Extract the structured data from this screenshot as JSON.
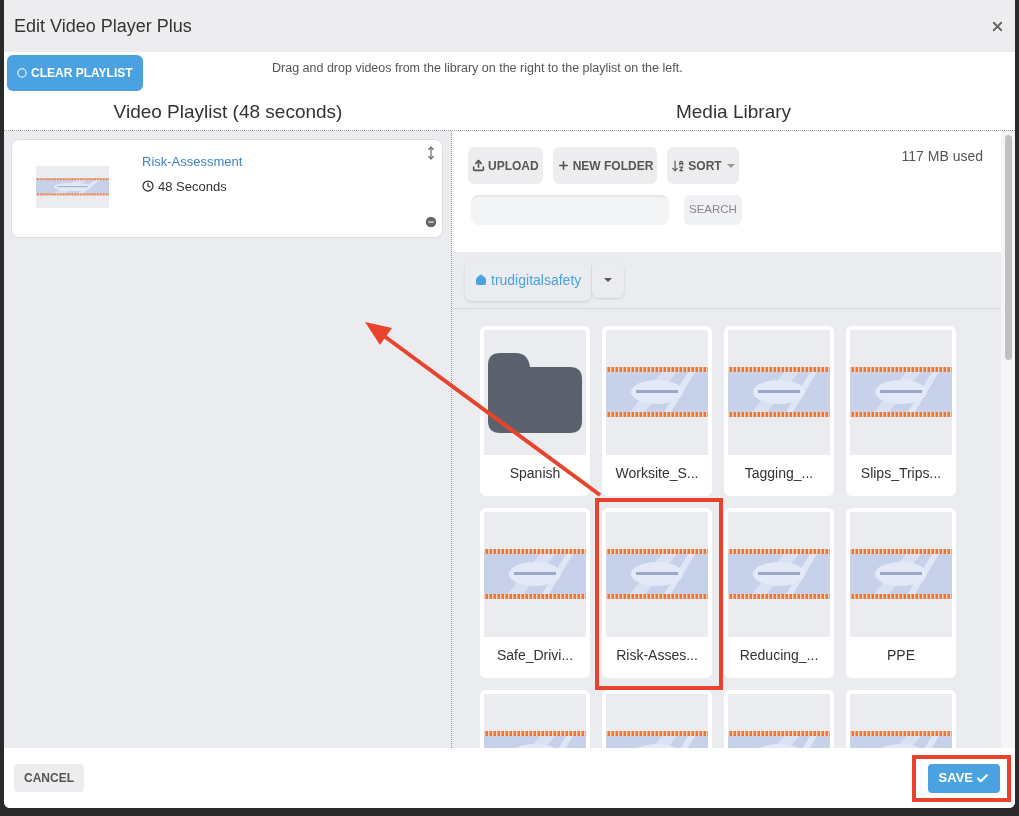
{
  "dialog": {
    "title": "Edit Video Player Plus"
  },
  "clear_button": "CLEAR PLAYLIST",
  "instructions": "Drag and drop videos from the library on the right to the playlist on the left.",
  "playlist": {
    "heading": "Video Playlist (48 seconds)",
    "items": [
      {
        "title": "Risk-Assessment",
        "duration": "48 Seconds"
      }
    ]
  },
  "library": {
    "heading": "Media Library",
    "usage": "117 MB used",
    "toolbar": [
      {
        "kind": "upload",
        "label": "UPLOAD"
      },
      {
        "kind": "new-folder",
        "label": "NEW FOLDER"
      },
      {
        "kind": "sort",
        "label": "SORT"
      }
    ],
    "search": {
      "button": "SEARCH"
    },
    "breadcrumb": "trudigitalsafety",
    "items": [
      {
        "kind": "folder",
        "name": "Spanish"
      },
      {
        "kind": "video",
        "name": "Worksite_S..."
      },
      {
        "kind": "video",
        "name": "Tagging_..."
      },
      {
        "kind": "video",
        "name": "Slips_Trips..."
      },
      {
        "kind": "video",
        "name": "Safe_Drivi..."
      },
      {
        "kind": "video",
        "name": "Risk-Asses..."
      },
      {
        "kind": "video",
        "name": "Reducing_..."
      },
      {
        "kind": "video",
        "name": "PPE"
      },
      {
        "kind": "video"
      },
      {
        "kind": "video"
      },
      {
        "kind": "video"
      },
      {
        "kind": "video"
      }
    ]
  },
  "footer": {
    "cancel": "CANCEL",
    "save": "SAVE"
  }
}
